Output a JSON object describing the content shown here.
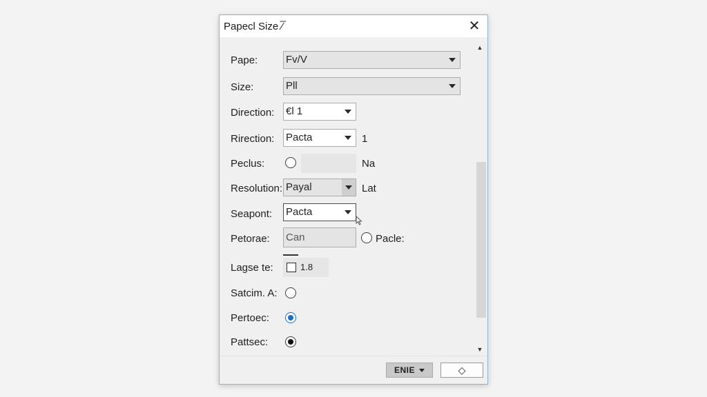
{
  "dialog": {
    "title": "Papecl Size ⁄̅",
    "close_glyph": "✕"
  },
  "rows": {
    "pape": {
      "label": "Pape:",
      "value": "Fv/V"
    },
    "size": {
      "label": "Size:",
      "value": "Pll"
    },
    "direction": {
      "label": "Direction:",
      "value": "€l 1"
    },
    "rirection": {
      "label": "Rirection:",
      "value": "Pacta",
      "aside": "1"
    },
    "peclus": {
      "label": "Peclus:",
      "aside": "Na"
    },
    "resolution": {
      "label": "Resolution:",
      "value": "Payal",
      "aside": "Lat"
    },
    "seapont": {
      "label": "Seapont:",
      "value": "Pacta"
    },
    "petorae": {
      "label": "Petorae:",
      "value": "Can",
      "radio_label": "Pacle:"
    },
    "lagsete": {
      "label": "Lagse te:",
      "value": "1.8"
    },
    "satcim": {
      "label": "Satcim. A:"
    },
    "pertoec": {
      "label": "Pertoec:"
    },
    "pattsec": {
      "label": "Pattsec:"
    }
  },
  "footer": {
    "ok_label": "ENIE",
    "alt_glyph": "◇"
  },
  "colors": {
    "accent": "#1a6fc4",
    "dialog_border": "#8fb3cf"
  },
  "icons": {
    "close": "close-icon",
    "scroll_up": "chevron-up-icon",
    "scroll_down": "chevron-down-icon"
  }
}
